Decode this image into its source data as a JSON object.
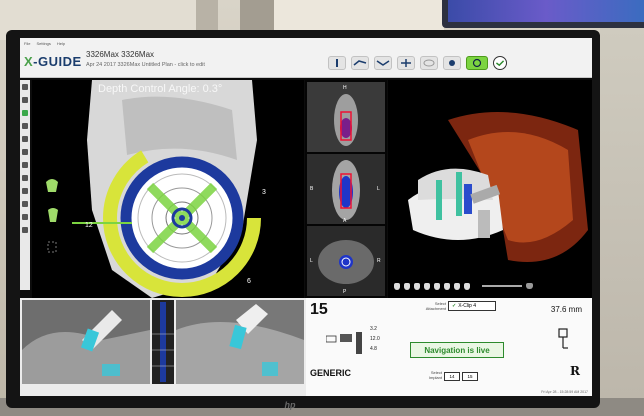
{
  "app": {
    "menu": [
      "File",
      "Settings",
      "Help"
    ],
    "logo_prefix": "X",
    "logo_text": "-GUIDE",
    "plan_title": "3326Max 3326Max",
    "plan_subtitle": "Apr 24 2017 3326Max Untitled Plan - click to edit"
  },
  "main_view": {
    "title": "Depth Control  Angle: 0.3°",
    "labels": [
      "12",
      "3",
      "6"
    ]
  },
  "slices": {
    "labels_top": [
      "H"
    ],
    "labels_mid": [
      "B",
      "L"
    ],
    "labels_mid2": [
      "A"
    ],
    "labels_bot": [
      "L",
      "R",
      "P"
    ]
  },
  "info": {
    "tooth_number": "15",
    "implant_type": "GENERIC",
    "attachment_label": "Select Attachment",
    "attachment_value": "X-Clip 4",
    "distance": "37.6 mm",
    "nav_status": "Navigation is live",
    "implant_select_label": "Select Implant",
    "implant_options": [
      "14",
      "15"
    ],
    "dims": [
      "3.2",
      "12.0",
      "4.8"
    ],
    "rx": "R",
    "timestamp": "Fri Apr 28 - 15:28:59 AM 2017"
  },
  "device": {
    "brand": "hp"
  },
  "colors": {
    "accent_green": "#7cd441",
    "nav_green": "#2d8a2d",
    "ring_blue": "#1d3a9e",
    "ring_yellow": "#d8e43a"
  }
}
